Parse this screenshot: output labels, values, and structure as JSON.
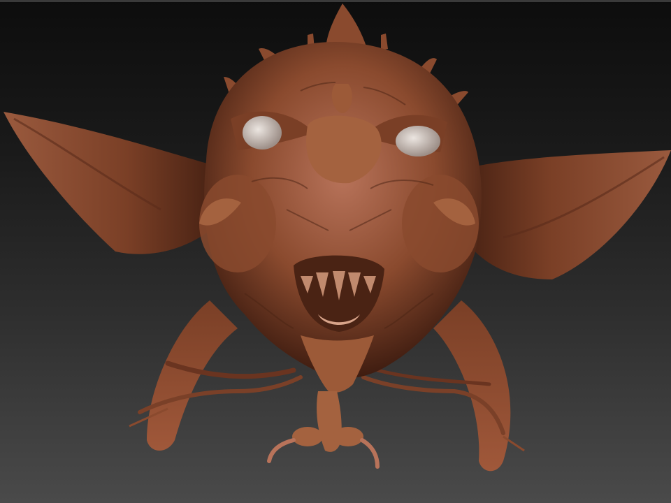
{
  "scene": {
    "subject": "creature-head-sculpt",
    "colors": {
      "background_top": "#0d0d0d",
      "background_bottom": "#4a4a4a",
      "skin_base": "#8a4a2e",
      "skin_highlight": "#b8735a",
      "skin_shadow": "#3e1c10",
      "eye": "#d9d2cc"
    }
  }
}
